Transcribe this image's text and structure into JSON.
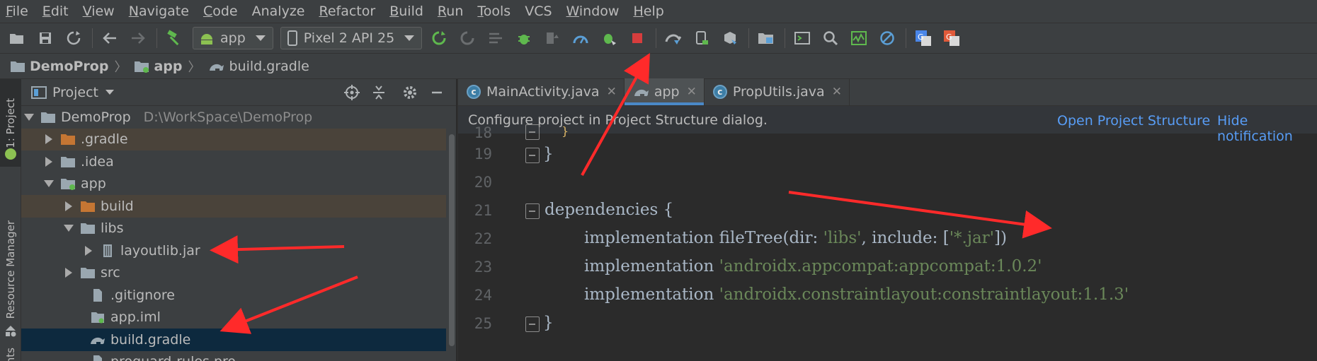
{
  "menu": [
    {
      "m": "F",
      "rest": "ile"
    },
    {
      "m": "E",
      "rest": "dit"
    },
    {
      "m": "V",
      "rest": "iew"
    },
    {
      "m": "N",
      "rest": "avigate"
    },
    {
      "m": "C",
      "rest": "ode"
    },
    {
      "m": "",
      "rest": "Analyze"
    },
    {
      "m": "R",
      "rest": "efactor"
    },
    {
      "m": "B",
      "rest": "uild"
    },
    {
      "m": "R",
      "rest": "un"
    },
    {
      "m": "T",
      "rest": "ools"
    },
    {
      "m": "",
      "rest": "VCS"
    },
    {
      "m": "W",
      "rest": "indow"
    },
    {
      "m": "H",
      "rest": "elp"
    }
  ],
  "toolbar": {
    "run_config": "app",
    "device": "Pixel 2 API 25"
  },
  "breadcrumb": {
    "project": "DemoProp",
    "module": "app",
    "file": "build.gradle"
  },
  "left_strip": {
    "project_tab": "1: Project",
    "resource_tab": "Resource Manager",
    "bottom_tab": "nts"
  },
  "project_panel": {
    "title": "Project",
    "tree": [
      {
        "label": "DemoProp",
        "path": "D:\\WorkSpace\\DemoProp"
      },
      {
        "label": ".gradle"
      },
      {
        "label": ".idea"
      },
      {
        "label": "app"
      },
      {
        "label": "build"
      },
      {
        "label": "libs"
      },
      {
        "label": "layoutlib.jar"
      },
      {
        "label": "src"
      },
      {
        "label": ".gitignore"
      },
      {
        "label": "app.iml"
      },
      {
        "label": "build.gradle"
      },
      {
        "label": "proguard-rules.pro"
      }
    ]
  },
  "editor": {
    "tabs": [
      {
        "label": "MainActivity.java"
      },
      {
        "label": "app"
      },
      {
        "label": "PropUtils.java"
      }
    ],
    "notification": {
      "message": "Configure project in Project Structure dialog.",
      "open_link": "Open Project Structure",
      "hide_link": "Hide notification"
    },
    "lines": {
      "n18": "18",
      "n19": "19",
      "n20": "20",
      "n21": "21",
      "n22": "22",
      "n23": "23",
      "n24": "24",
      "n25": "25",
      "l18": "}",
      "l19": "}",
      "l21": "dependencies {",
      "l22_a": "implementation fileTree(dir: ",
      "l22_s1": "'libs'",
      "l22_b": ", include: [",
      "l22_s2": "'*.jar'",
      "l22_c": "])",
      "l23_a": "implementation ",
      "l23_s": "'androidx.appcompat:appcompat:1.0.2'",
      "l24_a": "implementation ",
      "l24_s": "'androidx.constraintlayout:constraintlayout:1.1.3'",
      "l25": "}"
    }
  },
  "colors": {
    "accent": "#4a88c7",
    "link": "#589df6",
    "string": "#6a8759",
    "annotation_arrow": "#ff2a2a"
  }
}
